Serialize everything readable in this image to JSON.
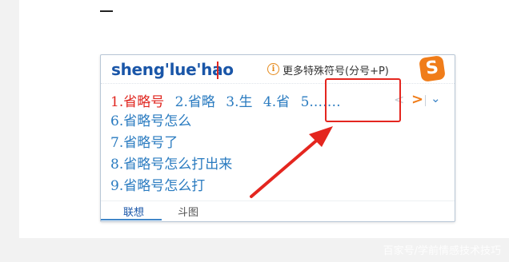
{
  "ime": {
    "pinyin": "sheng'lue'hao",
    "more_link": "更多特殊符号(分号+P)",
    "logo_letter": "S",
    "candidates_row": [
      {
        "num": "1.",
        "text": "省略号"
      },
      {
        "num": "2.",
        "text": "省略"
      },
      {
        "num": "3.",
        "text": "生"
      },
      {
        "num": "4.",
        "text": "省"
      },
      {
        "num": "5.",
        "text": "……"
      }
    ],
    "candidates_list": [
      "6.省略号怎么",
      "7.省略号了",
      "8.省略号怎么打出来",
      "9.省略号怎么打"
    ],
    "nav": {
      "prev": "<",
      "next": ">",
      "expand": "⌄"
    },
    "tabs": [
      "联想",
      "斗图"
    ]
  },
  "colors": {
    "pinyin": "#1a56a8",
    "selected_candidate": "#e0261f",
    "candidate": "#2a7bc0",
    "annotation": "#e4261f",
    "logo": "#f07d1a"
  },
  "watermark": "百家号/学前情感技术技巧"
}
